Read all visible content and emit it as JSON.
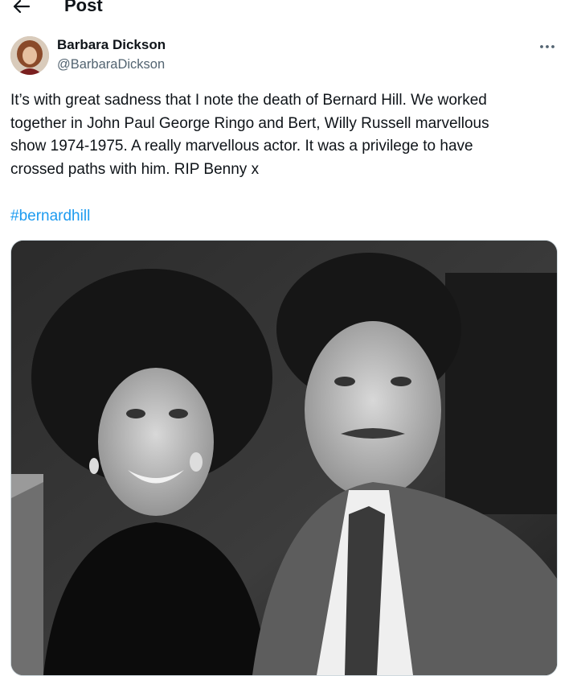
{
  "header": {
    "title": "Post",
    "back_icon": "arrow-left-icon"
  },
  "author": {
    "display_name": "Barbara Dickson",
    "handle": "@BarbaraDickson",
    "more_icon": "more-horizontal-icon"
  },
  "post": {
    "text": "It’s with great sadness that I note the death of Bernard Hill. We worked\ntogether in John Paul George Ringo and Bert, Willy Russell marvellous\nshow 1974-1975. A really marvellous actor. It was a privilege to have\ncrossed paths with him. RIP Benny x",
    "hashtag": "#bernardhill"
  },
  "colors": {
    "link": "#1d9bf0",
    "secondary_text": "#536471",
    "primary_text": "#0f1419"
  }
}
